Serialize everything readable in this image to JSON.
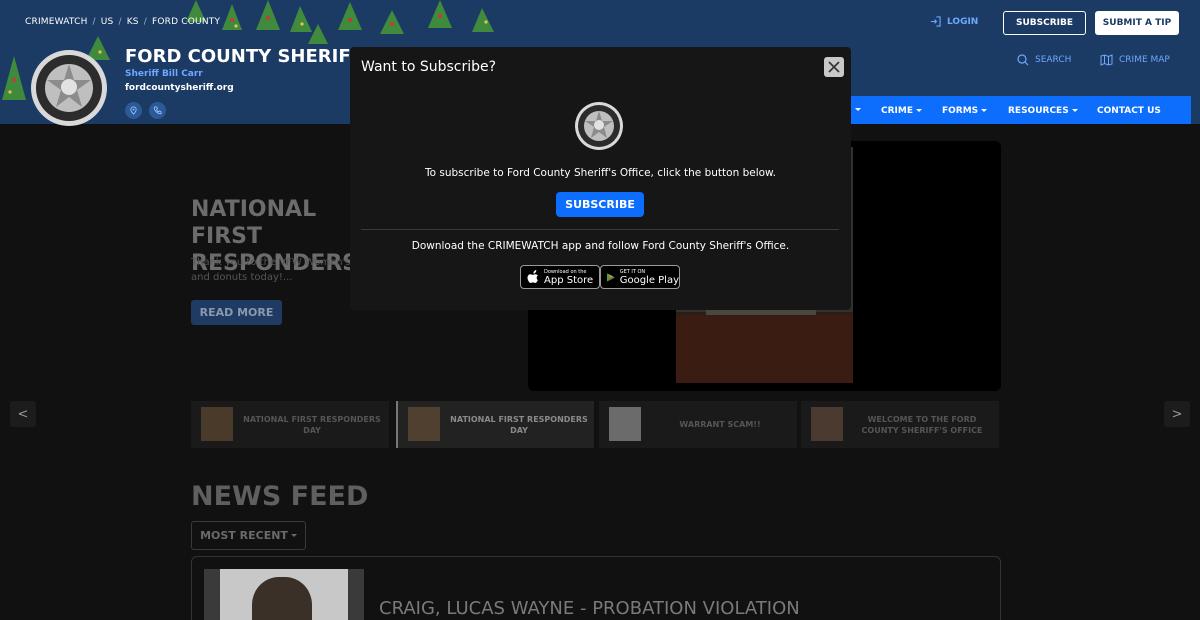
{
  "breadcrumb": [
    "CRIMEWATCH",
    "US",
    "KS",
    "FORD COUNTY"
  ],
  "agency": {
    "title": "FORD COUNTY SHERIFF'S",
    "sheriff": "Sheriff Bill Carr",
    "url": "fordcountysheriff.org"
  },
  "header": {
    "login": "LOGIN",
    "subscribe": "SUBSCRIBE",
    "submit_tip": "SUBMIT A TIP",
    "search": "SEARCH",
    "crime_map": "CRIME MAP"
  },
  "nav": [
    "CRIME",
    "FORMS",
    "RESOURCES",
    "CONTACT US"
  ],
  "hero": {
    "title": "NATIONAL FIRST\nRESPONDERS",
    "text": "Thank you to the VFW Women's\nand donuts today!...",
    "read_more": "READ MORE",
    "prev": "<",
    "next": ">"
  },
  "thumbnails": [
    {
      "label": "NATIONAL FIRST RESPONDERS DAY"
    },
    {
      "label": "NATIONAL FIRST RESPONDERS DAY"
    },
    {
      "label": "WARRANT SCAM!!"
    },
    {
      "label": "WELCOME TO THE FORD COUNTY SHERIFF'S OFFICE"
    }
  ],
  "news": {
    "title": "NEWS FEED",
    "sort": "MOST RECENT",
    "first_item": "CRAIG, LUCAS WAYNE - PROBATION VIOLATION"
  },
  "modal": {
    "title": "Want to Subscribe?",
    "text": "To subscribe to Ford County Sheriff's Office, click the button below.",
    "subscribe_btn": "SUBSCRIBE",
    "download_text": "Download the CRIMEWATCH app and follow Ford County Sheriff's Office.",
    "app_store_small": "Download on the",
    "app_store_big": "App Store",
    "play_small": "GET IT ON",
    "play_big": "Google Play"
  },
  "colors": {
    "header_bg": "#1b3a64",
    "accent": "#0d6efd",
    "link": "#6ea8ff",
    "modal_bg": "#161616"
  }
}
